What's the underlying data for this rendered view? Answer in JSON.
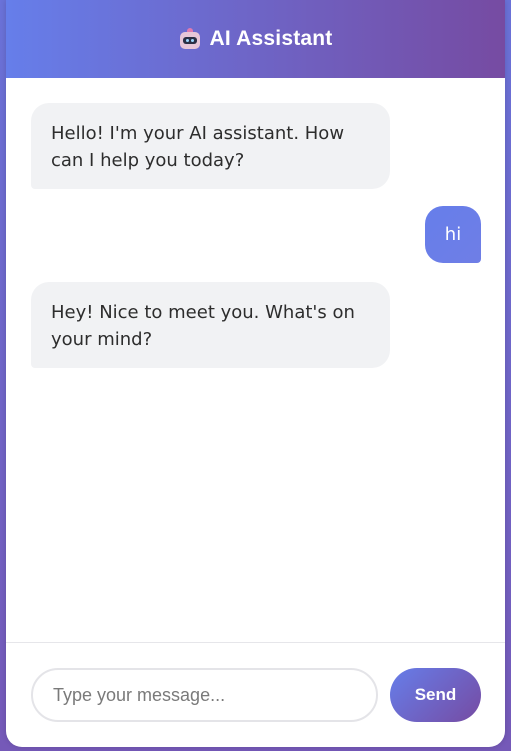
{
  "header": {
    "icon": "robot-icon",
    "title": "AI Assistant"
  },
  "messages": [
    {
      "sender": "bot",
      "text": "Hello! I'm your AI assistant. How can I help you today?"
    },
    {
      "sender": "user",
      "text": "hi"
    },
    {
      "sender": "bot",
      "text": "Hey! Nice to meet you. What's on your mind?"
    }
  ],
  "composer": {
    "placeholder": "Type your message...",
    "value": "",
    "send_label": "Send"
  },
  "colors": {
    "accent_start": "#667eea",
    "accent_end": "#764ba2",
    "bot_bubble": "#f1f2f4"
  }
}
